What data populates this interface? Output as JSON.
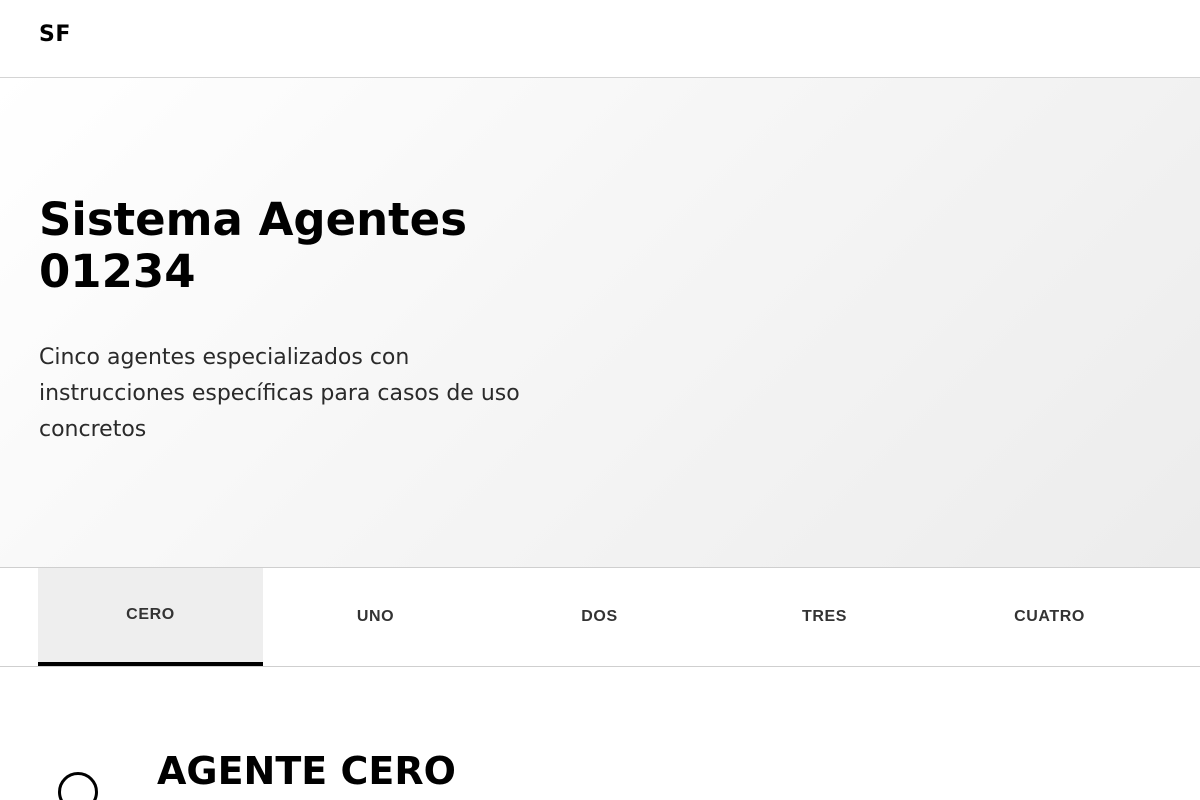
{
  "header": {
    "logo": "SF"
  },
  "hero": {
    "title": "Sistema Agentes 01234",
    "subtitle": "Cinco agentes especializados con instrucciones específicas para casos de uso concretos"
  },
  "tabs": [
    {
      "label": "CERO",
      "active": true
    },
    {
      "label": "UNO",
      "active": false
    },
    {
      "label": "DOS",
      "active": false
    },
    {
      "label": "TRES",
      "active": false
    },
    {
      "label": "CUATRO",
      "active": false
    }
  ],
  "agent": {
    "title": "AGENTE CERO",
    "icon": "circle-icon"
  }
}
